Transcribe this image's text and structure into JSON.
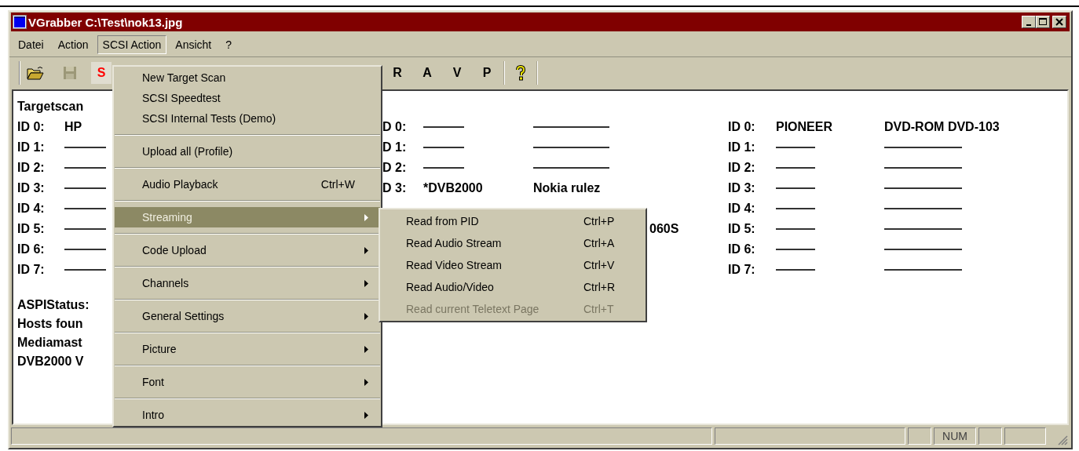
{
  "window": {
    "title": "VGrabber C:\\Test\\nok13.jpg"
  },
  "menu_bar": [
    {
      "label": "Datei",
      "selected": false
    },
    {
      "label": "Action",
      "selected": false
    },
    {
      "label": "SCSI Action",
      "selected": true
    },
    {
      "label": "Ansicht",
      "selected": false
    },
    {
      "label": "?",
      "selected": false
    }
  ],
  "toolbar": {
    "left_buttons": [
      {
        "label": "S",
        "color": "#ff0000"
      }
    ],
    "right_buttons": [
      {
        "label": "R",
        "color": "#000000"
      },
      {
        "label": "A",
        "color": "#000000"
      },
      {
        "label": "V",
        "color": "#000000"
      },
      {
        "label": "P",
        "color": "#000000"
      }
    ]
  },
  "scan": {
    "heading": "Targetscan",
    "left_rows": [
      {
        "id": "ID 0:",
        "cells": [
          {
            "kind": "text",
            "text": "HP"
          }
        ]
      },
      {
        "id": "ID 1:",
        "cells": [
          {
            "kind": "empty"
          }
        ]
      },
      {
        "id": "ID 2:",
        "cells": [
          {
            "kind": "empty"
          }
        ]
      },
      {
        "id": "ID 3:",
        "cells": [
          {
            "kind": "empty"
          }
        ]
      },
      {
        "id": "ID 4:",
        "cells": [
          {
            "kind": "empty"
          }
        ]
      },
      {
        "id": "ID 5:",
        "cells": [
          {
            "kind": "empty"
          }
        ]
      },
      {
        "id": "ID 6:",
        "cells": [
          {
            "kind": "empty"
          }
        ]
      },
      {
        "id": "ID 7:",
        "cells": [
          {
            "kind": "empty"
          }
        ]
      }
    ],
    "status_lines": [
      "ASPIStatus:",
      "Hosts foun",
      "Mediamast",
      "DVB2000 V"
    ],
    "middle_rows": [
      {
        "id": "D 0:",
        "cells": [
          {
            "kind": "empty"
          },
          {
            "kind": "empty"
          }
        ]
      },
      {
        "id": "D 1:",
        "cells": [
          {
            "kind": "empty"
          },
          {
            "kind": "empty"
          }
        ]
      },
      {
        "id": "D 2:",
        "cells": [
          {
            "kind": "empty"
          },
          {
            "kind": "empty"
          }
        ]
      },
      {
        "id": "D 3:",
        "cells": [
          {
            "kind": "text",
            "text": "*DVB2000"
          },
          {
            "kind": "text",
            "text": "Nokia rulez"
          }
        ]
      }
    ],
    "middle_fragment": "060S",
    "right_rows": [
      {
        "id": "ID 0:",
        "cells": [
          {
            "kind": "text",
            "text": "PIONEER"
          },
          {
            "kind": "text",
            "text": "DVD-ROM DVD-103"
          }
        ]
      },
      {
        "id": "ID 1:",
        "cells": [
          {
            "kind": "empty"
          },
          {
            "kind": "empty"
          }
        ]
      },
      {
        "id": "ID 2:",
        "cells": [
          {
            "kind": "empty"
          },
          {
            "kind": "empty"
          }
        ]
      },
      {
        "id": "ID 3:",
        "cells": [
          {
            "kind": "empty"
          },
          {
            "kind": "empty"
          }
        ]
      },
      {
        "id": "ID 4:",
        "cells": [
          {
            "kind": "empty"
          },
          {
            "kind": "empty"
          }
        ]
      },
      {
        "id": "ID 5:",
        "cells": [
          {
            "kind": "empty"
          },
          {
            "kind": "empty"
          }
        ]
      },
      {
        "id": "ID 6:",
        "cells": [
          {
            "kind": "empty"
          },
          {
            "kind": "empty"
          }
        ]
      },
      {
        "id": "ID 7:",
        "cells": [
          {
            "kind": "empty"
          },
          {
            "kind": "empty"
          }
        ]
      }
    ]
  },
  "dropdown": [
    {
      "kind": "item",
      "label": "New Target Scan",
      "selected": false
    },
    {
      "kind": "item",
      "label": "SCSI Speedtest",
      "selected": false
    },
    {
      "kind": "item",
      "label": "SCSI Internal Tests (Demo)",
      "selected": false
    },
    {
      "kind": "separator"
    },
    {
      "kind": "item",
      "label": "Upload all (Profile)",
      "selected": false
    },
    {
      "kind": "separator"
    },
    {
      "kind": "item",
      "label": "Audio Playback",
      "shortcut": "Ctrl+W",
      "selected": false
    },
    {
      "kind": "separator"
    },
    {
      "kind": "item",
      "label": "Streaming",
      "submenu": true,
      "selected": true
    },
    {
      "kind": "separator"
    },
    {
      "kind": "item",
      "label": "Code Upload",
      "submenu": true,
      "selected": false
    },
    {
      "kind": "separator"
    },
    {
      "kind": "item",
      "label": "Channels",
      "submenu": true,
      "selected": false
    },
    {
      "kind": "separator"
    },
    {
      "kind": "item",
      "label": "General Settings",
      "submenu": true,
      "selected": false
    },
    {
      "kind": "separator"
    },
    {
      "kind": "item",
      "label": "Picture",
      "submenu": true,
      "selected": false
    },
    {
      "kind": "separator"
    },
    {
      "kind": "item",
      "label": "Font",
      "submenu": true,
      "selected": false
    },
    {
      "kind": "separator"
    },
    {
      "kind": "item",
      "label": "Intro",
      "submenu": true,
      "selected": false
    }
  ],
  "submenu": [
    {
      "label": "Read from PID",
      "shortcut": "Ctrl+P",
      "disabled": false
    },
    {
      "label": "Read Audio Stream",
      "shortcut": "Ctrl+A",
      "disabled": false
    },
    {
      "label": "Read Video Stream",
      "shortcut": "Ctrl+V",
      "disabled": false
    },
    {
      "label": "Read Audio/Video",
      "shortcut": "Ctrl+R",
      "disabled": false
    },
    {
      "label": "Read current Teletext Page",
      "shortcut": "Ctrl+T",
      "disabled": true
    }
  ],
  "status_bar": {
    "indicator": "NUM"
  }
}
